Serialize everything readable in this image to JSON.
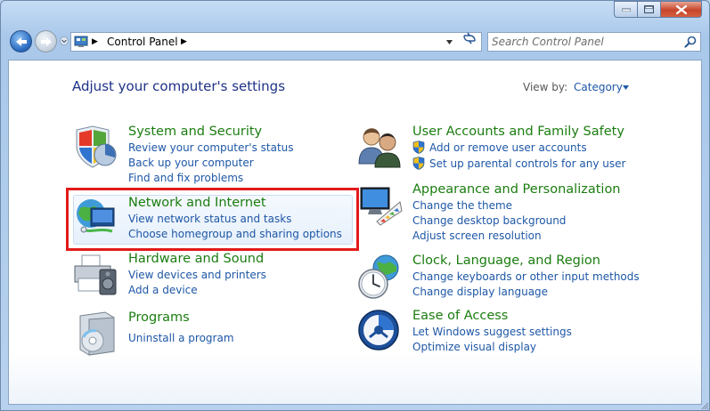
{
  "address": {
    "path": "Control Panel"
  },
  "search": {
    "placeholder": "Search Control Panel"
  },
  "main": {
    "title": "Adjust your computer's settings",
    "view_by_label": "View by:",
    "view_by_value": "Category"
  },
  "categories": {
    "system": {
      "title": "System and Security",
      "links": [
        "Review your computer's status",
        "Back up your computer",
        "Find and fix problems"
      ]
    },
    "network": {
      "title": "Network and Internet",
      "links": [
        "View network status and tasks",
        "Choose homegroup and sharing options"
      ]
    },
    "hardware": {
      "title": "Hardware and Sound",
      "links": [
        "View devices and printers",
        "Add a device"
      ]
    },
    "programs": {
      "title": "Programs",
      "links": [
        "Uninstall a program"
      ]
    },
    "users": {
      "title": "User Accounts and Family Safety",
      "links": [
        "Add or remove user accounts",
        "Set up parental controls for any user"
      ]
    },
    "appearance": {
      "title": "Appearance and Personalization",
      "links": [
        "Change the theme",
        "Change desktop background",
        "Adjust screen resolution"
      ]
    },
    "clock": {
      "title": "Clock, Language, and Region",
      "links": [
        "Change keyboards or other input methods",
        "Change display language"
      ]
    },
    "ease": {
      "title": "Ease of Access",
      "links": [
        "Let Windows suggest settings",
        "Optimize visual display"
      ]
    }
  },
  "colors": {
    "title_text": "#1e3287",
    "category_title": "#1b7d10",
    "link": "#1e57a6",
    "highlight_border": "#e21a1a"
  },
  "icons": {
    "system": "shield-pie-icon",
    "network": "globe-network-icon",
    "hardware": "printer-speaker-icon",
    "programs": "program-box-icon",
    "users": "users-icon",
    "appearance": "monitor-palette-icon",
    "clock": "clock-globe-icon",
    "ease": "accessibility-icon",
    "uac": "uac-shield-icon"
  }
}
